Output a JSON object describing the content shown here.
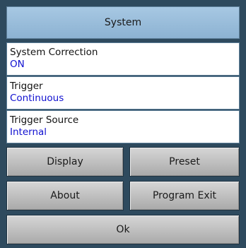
{
  "window": {
    "title": "System"
  },
  "fields": [
    {
      "label": "System Correction",
      "value": "ON"
    },
    {
      "label": "Trigger",
      "value": "Continuous"
    },
    {
      "label": "Trigger Source",
      "value": "Internal"
    }
  ],
  "buttons": {
    "display": "Display",
    "preset": "Preset",
    "about": "About",
    "program_exit": "Program Exit",
    "ok": "Ok"
  },
  "colors": {
    "panel_background": "#2e4a5e",
    "title_bar": "#9bbfdc",
    "field_value_text": "#1010d0",
    "button_face": "#c2c2c2"
  }
}
